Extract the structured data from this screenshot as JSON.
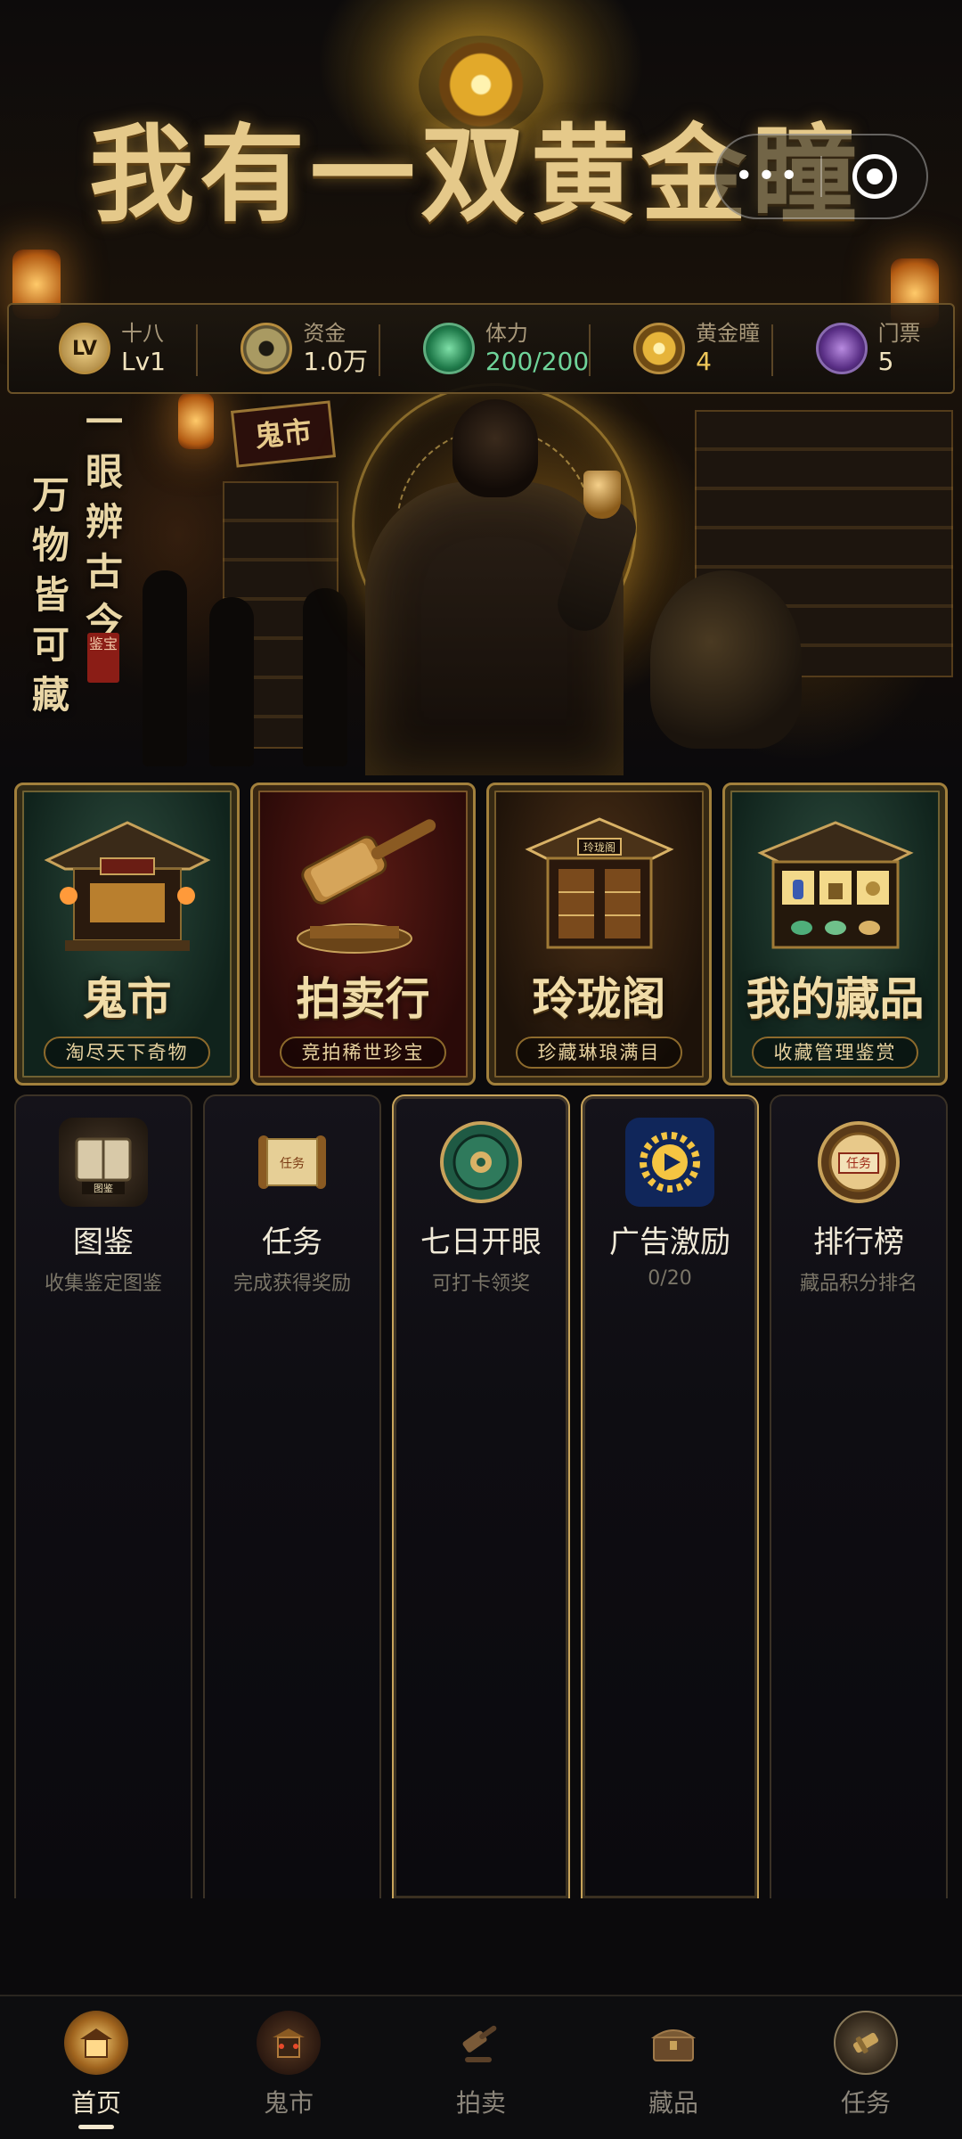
{
  "header": {
    "game_title": "我有一双黄金瞳",
    "more_icon": "more-dots-icon",
    "close_icon": "target-close-icon"
  },
  "stats": [
    {
      "label": "十八",
      "value": "Lv1",
      "icon": "level-badge-icon",
      "icon_text": "LV"
    },
    {
      "label": "资金",
      "value": "1.0万",
      "icon": "coin-icon"
    },
    {
      "label": "体力",
      "value": "200/200",
      "icon": "jade-stamina-icon"
    },
    {
      "label": "黄金瞳",
      "value": "4",
      "icon": "golden-eye-icon"
    },
    {
      "label": "门票",
      "value": "5",
      "icon": "ticket-icon"
    }
  ],
  "hero": {
    "slogan_line1": "一眼辨古今",
    "slogan_line2": "万物皆可藏",
    "seal_text": "鉴宝",
    "shop_sign": "鬼市"
  },
  "feature_cards": [
    {
      "title": "鬼市",
      "subtitle": "淘尽天下奇物",
      "theme": "green",
      "icon": "market-pavilion-icon"
    },
    {
      "title": "拍卖行",
      "subtitle": "竞拍稀世珍宝",
      "theme": "red",
      "icon": "gavel-icon"
    },
    {
      "title": "玲珑阁",
      "subtitle": "珍藏琳琅满目",
      "theme": "brown",
      "icon": "treasure-pavilion-icon",
      "sign": "玲珑阁"
    },
    {
      "title": "我的藏品",
      "subtitle": "收藏管理鉴赏",
      "theme": "green",
      "icon": "collection-cabinet-icon"
    }
  ],
  "functions": [
    {
      "title": "图鉴",
      "subtitle": "收集鉴定图鉴",
      "icon": "catalog-book-icon",
      "icon_text": "图鉴"
    },
    {
      "title": "任务",
      "subtitle": "完成获得奖励",
      "icon": "task-scroll-icon",
      "icon_text": "任务"
    },
    {
      "title": "七日开眼",
      "subtitle": "可打卡领奖",
      "icon": "jade-disc-icon"
    },
    {
      "title": "广告激励",
      "subtitle": "0/20",
      "icon": "video-reward-icon"
    },
    {
      "title": "排行榜",
      "subtitle": "藏品积分排名",
      "icon": "rank-badge-icon",
      "icon_text": "任务"
    }
  ],
  "nav": [
    {
      "label": "首页",
      "icon": "home-palace-icon",
      "active": true
    },
    {
      "label": "鬼市",
      "icon": "market-icon",
      "active": false
    },
    {
      "label": "拍卖",
      "icon": "gavel-icon",
      "active": false
    },
    {
      "label": "藏品",
      "icon": "treasure-chest-icon",
      "active": false
    },
    {
      "label": "任务",
      "icon": "task-icon",
      "active": false
    }
  ],
  "colors": {
    "gold": "#e5c98a",
    "stamina_green": "#6fd49a",
    "eye_gold": "#f0c85a",
    "background": "#0b0a0c"
  }
}
